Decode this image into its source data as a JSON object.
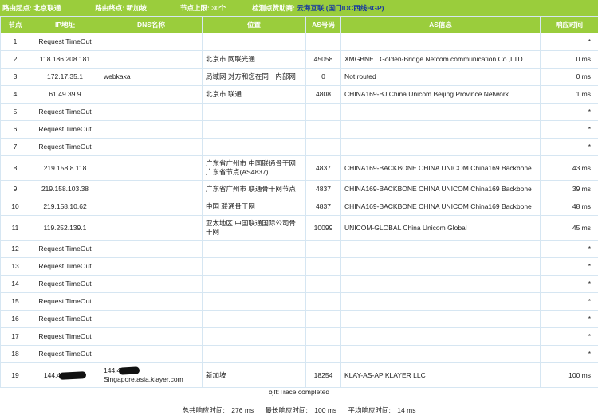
{
  "header": {
    "route_start_label": "路由起点:",
    "route_start": "北京联通",
    "route_end_label": "路由终点:",
    "route_end": "新加坡",
    "hop_limit_label": "节点上限:",
    "hop_limit": "30个",
    "sponsor_label": "检测点赞助商:",
    "sponsor_name": "云海互联",
    "sponsor_detail": "(国门IDC西线BGP)"
  },
  "table": {
    "columns": [
      "节点",
      "IP地址",
      "DNS名称",
      "位置",
      "AS号码",
      "AS信息",
      "响应时间"
    ],
    "rows": [
      {
        "hop": "1",
        "ip": "Request TimeOut",
        "dns": "",
        "loc": "",
        "as": "",
        "asinfo": "",
        "time": "*"
      },
      {
        "hop": "2",
        "ip": "118.186.208.181",
        "dns": "",
        "loc": "北京市 网联光通",
        "as": "45058",
        "asinfo": "XMGBNET Golden-Bridge Netcom communication Co.,LTD.",
        "time": "0 ms"
      },
      {
        "hop": "3",
        "ip": "172.17.35.1",
        "dns": "webkaka",
        "loc": "局域网 对方和您在同一内部网",
        "as": "0",
        "asinfo": "Not routed",
        "time": "0 ms"
      },
      {
        "hop": "4",
        "ip": "61.49.39.9",
        "dns": "",
        "loc": "北京市 联通",
        "as": "4808",
        "asinfo": "CHINA169-BJ China Unicom Beijing Province Network",
        "time": "1 ms"
      },
      {
        "hop": "5",
        "ip": "Request TimeOut",
        "dns": "",
        "loc": "",
        "as": "",
        "asinfo": "",
        "time": "*"
      },
      {
        "hop": "6",
        "ip": "Request TimeOut",
        "dns": "",
        "loc": "",
        "as": "",
        "asinfo": "",
        "time": "*"
      },
      {
        "hop": "7",
        "ip": "Request TimeOut",
        "dns": "",
        "loc": "",
        "as": "",
        "asinfo": "",
        "time": "*"
      },
      {
        "hop": "8",
        "ip": "219.158.8.118",
        "dns": "",
        "loc": "广东省广州市 中国联通骨干网广东省节点(AS4837)",
        "as": "4837",
        "asinfo": "CHINA169-BACKBONE CHINA UNICOM China169 Backbone",
        "time": "43 ms"
      },
      {
        "hop": "9",
        "ip": "219.158.103.38",
        "dns": "",
        "loc": "广东省广州市 联通骨干网节点",
        "as": "4837",
        "asinfo": "CHINA169-BACKBONE CHINA UNICOM China169 Backbone",
        "time": "39 ms"
      },
      {
        "hop": "10",
        "ip": "219.158.10.62",
        "dns": "",
        "loc": "中国 联通骨干网",
        "as": "4837",
        "asinfo": "CHINA169-BACKBONE CHINA UNICOM China169 Backbone",
        "time": "48 ms"
      },
      {
        "hop": "11",
        "ip": "119.252.139.1",
        "dns": "",
        "loc": "亚太地区 中国联通国际公司骨干网",
        "as": "10099",
        "asinfo": "UNICOM-GLOBAL China Unicom Global",
        "time": "45 ms"
      },
      {
        "hop": "12",
        "ip": "Request TimeOut",
        "dns": "",
        "loc": "",
        "as": "",
        "asinfo": "",
        "time": "*"
      },
      {
        "hop": "13",
        "ip": "Request TimeOut",
        "dns": "",
        "loc": "",
        "as": "",
        "asinfo": "",
        "time": "*"
      },
      {
        "hop": "14",
        "ip": "Request TimeOut",
        "dns": "",
        "loc": "",
        "as": "",
        "asinfo": "",
        "time": "*"
      },
      {
        "hop": "15",
        "ip": "Request TimeOut",
        "dns": "",
        "loc": "",
        "as": "",
        "asinfo": "",
        "time": "*"
      },
      {
        "hop": "16",
        "ip": "Request TimeOut",
        "dns": "",
        "loc": "",
        "as": "",
        "asinfo": "",
        "time": "*"
      },
      {
        "hop": "17",
        "ip": "Request TimeOut",
        "dns": "",
        "loc": "",
        "as": "",
        "asinfo": "",
        "time": "*"
      },
      {
        "hop": "18",
        "ip": "Request TimeOut",
        "dns": "",
        "loc": "",
        "as": "",
        "asinfo": "",
        "time": "*"
      },
      {
        "hop": "19",
        "ip": "144.4",
        "dns": "144.4",
        "dns_suffix": "Singapore.asia.klayer.com",
        "loc": "新加坡",
        "as": "18254",
        "asinfo": "KLAY-AS-AP KLAYER LLC",
        "time": "100 ms"
      }
    ]
  },
  "footer": {
    "completed_text": "bjlt:Trace completed",
    "total_label": "总共响应时间:",
    "total_value": "276 ms",
    "max_label": "最长响应时间:",
    "max_value": "100 ms",
    "avg_label": "平均响应时间:",
    "avg_value": "14 ms"
  },
  "colors": {
    "accent_green": "#9acd3c",
    "sponsor_link": "#1a3c9e",
    "grid_border": "#d6e6f2"
  }
}
